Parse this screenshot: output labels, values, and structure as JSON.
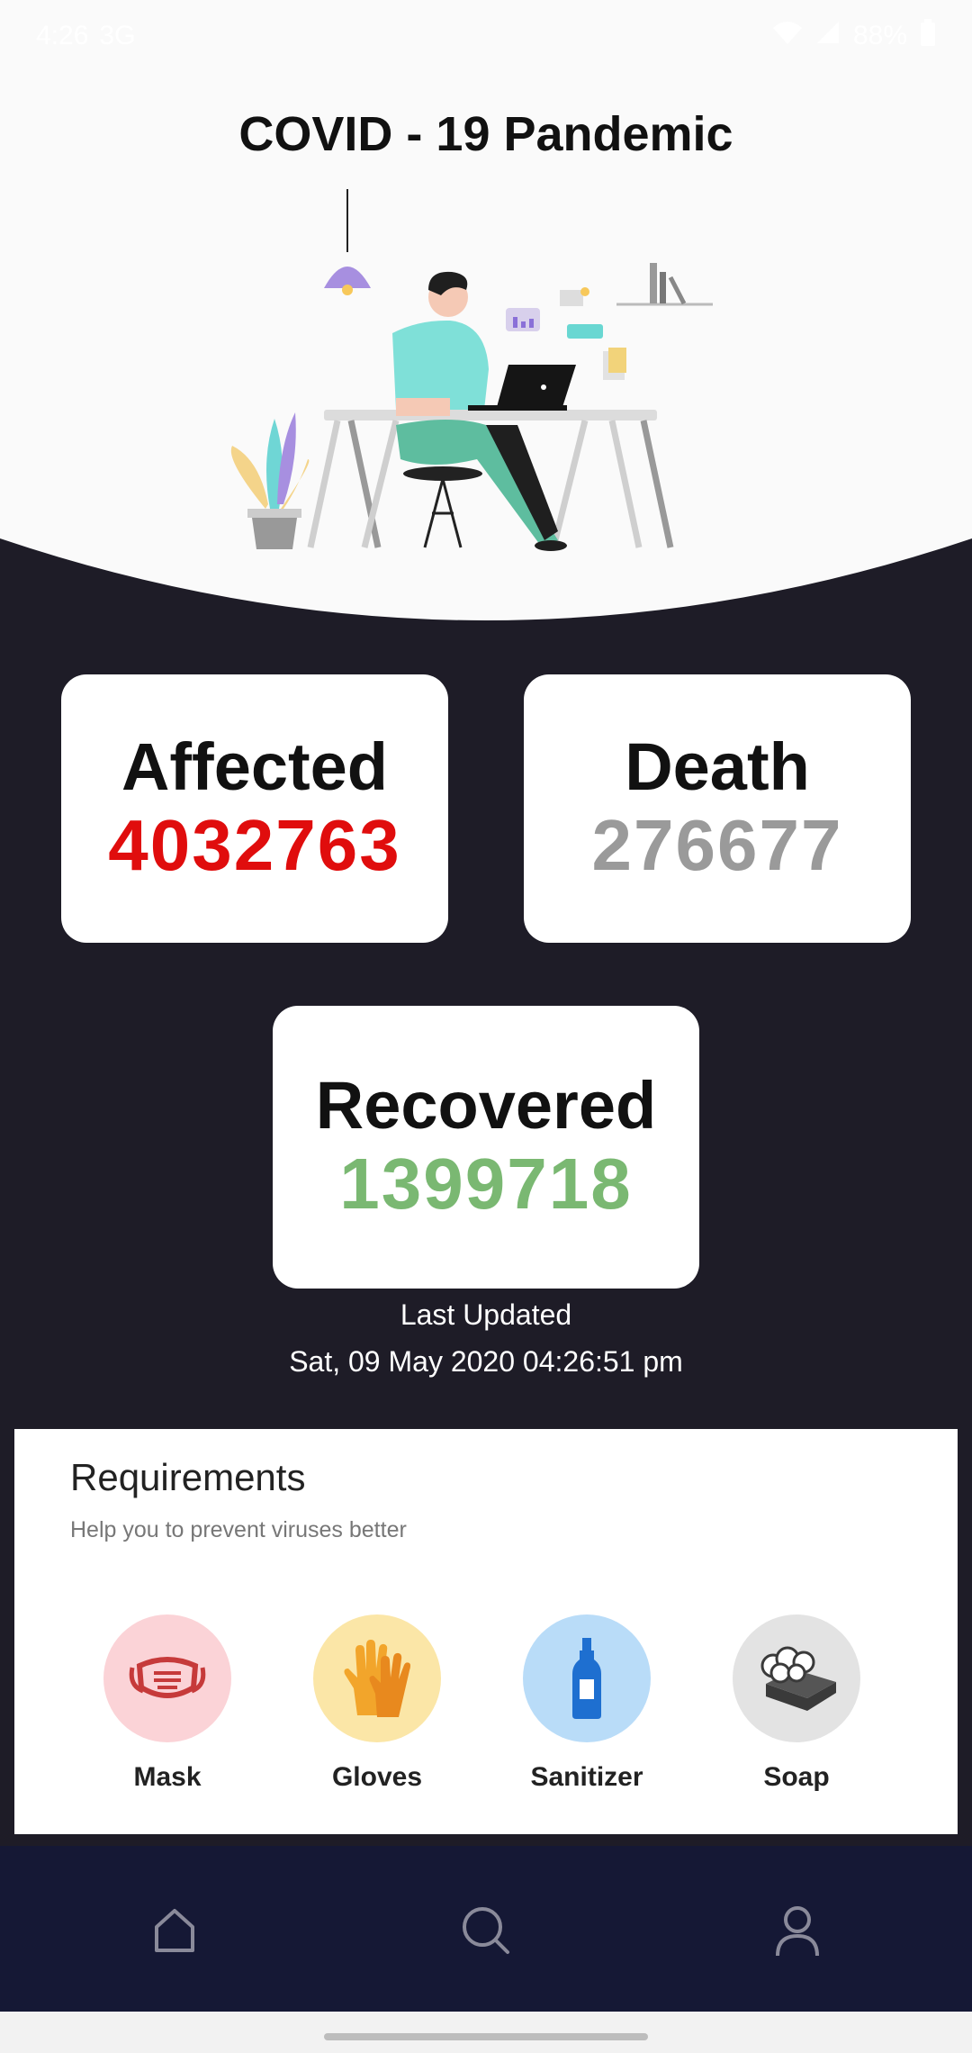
{
  "status_bar": {
    "time": "4:26",
    "extra": "3G",
    "battery": "88%"
  },
  "header": {
    "title": "COVID - 19 Pandemic"
  },
  "stats": {
    "affected": {
      "label": "Affected",
      "value": "4032763",
      "color": "#e00d0d"
    },
    "death": {
      "label": "Death",
      "value": "276677",
      "color": "#9a9a9a"
    },
    "recovered": {
      "label": "Recovered",
      "value": "1399718",
      "color": "#7ab872"
    }
  },
  "last_updated": {
    "label": "Last Updated",
    "datetime": "Sat, 09 May 2020 04:26:51 pm"
  },
  "requirements": {
    "title": "Requirements",
    "subtitle": "Help you to prevent viruses better",
    "items": [
      {
        "label": "Mask",
        "icon": "mask-icon",
        "bg": "#fbd3d7"
      },
      {
        "label": "Gloves",
        "icon": "gloves-icon",
        "bg": "#fbe6a7"
      },
      {
        "label": "Sanitizer",
        "icon": "sanitizer-icon",
        "bg": "#b9dcf8"
      },
      {
        "label": "Soap",
        "icon": "soap-icon",
        "bg": "#e3e3e3"
      }
    ]
  },
  "bottom_nav": {
    "items": [
      {
        "name": "home",
        "icon": "home-icon"
      },
      {
        "name": "search",
        "icon": "search-icon"
      },
      {
        "name": "profile",
        "icon": "profile-icon"
      }
    ]
  }
}
